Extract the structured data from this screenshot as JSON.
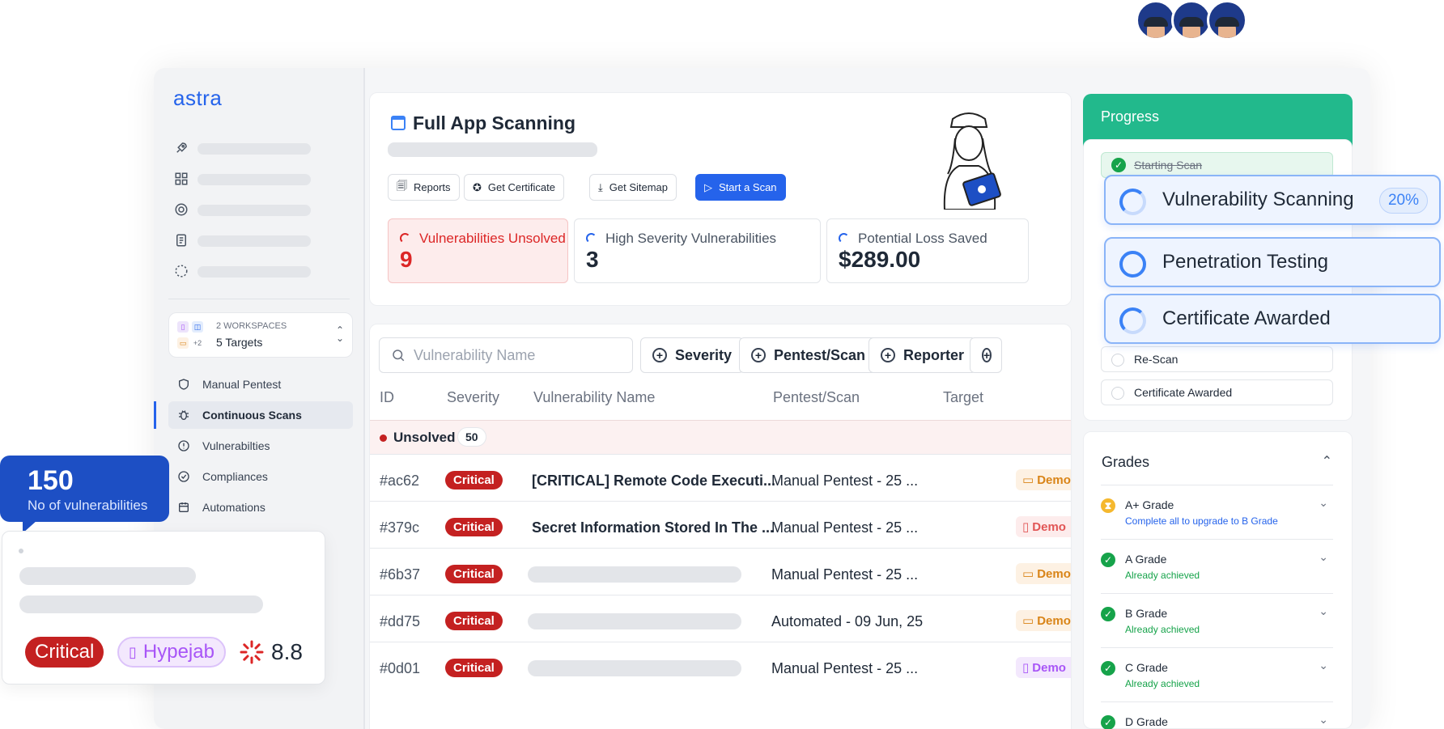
{
  "brand": {
    "logo_text": "astra",
    "accent": "#2563eb",
    "success": "#22b98c",
    "danger": "#c42121"
  },
  "sidebar": {
    "nav_icons": [
      "rocket-icon",
      "grid-icon",
      "target-icon",
      "report-icon",
      "scan-icon"
    ],
    "workspace": {
      "title": "2 WORKSPACES",
      "subtitle": "5 Targets",
      "extra_count": "+2"
    },
    "menu": [
      {
        "label": "Manual Pentest",
        "icon": "shield-icon"
      },
      {
        "label": "Continuous Scans",
        "icon": "bug-icon",
        "active": true
      },
      {
        "label": "Vulnerabilties",
        "icon": "alert-icon"
      },
      {
        "label": "Compliances",
        "icon": "badge-check-icon"
      },
      {
        "label": "Automations",
        "icon": "calendar-icon"
      }
    ]
  },
  "header": {
    "title": "Full App Scanning",
    "buttons": {
      "reports": "Reports",
      "certificate": "Get Certificate",
      "sitemap": "Get Sitemap",
      "start": "Start a Scan"
    }
  },
  "stats": [
    {
      "label": "Vulnerabilities Unsolved",
      "value": "9"
    },
    {
      "label": "High Severity Vulnerabilities",
      "value": "3"
    },
    {
      "label": "Potential Loss Saved",
      "value": "$289.00"
    }
  ],
  "filters": {
    "search_placeholder": "Vulnerability Name",
    "severity": "Severity",
    "pentest": "Pentest/Scan",
    "reporter": "Reporter"
  },
  "table": {
    "columns": [
      "ID",
      "Severity",
      "Vulnerability Name",
      "Pentest/Scan",
      "Target"
    ],
    "group": {
      "label": "Unsolved",
      "count": "50"
    },
    "rows": [
      {
        "id": "#ac62",
        "severity": "Critical",
        "name": "[CRITICAL] Remote Code Executi...",
        "scan": "Manual Pentest - 25 ...",
        "target": "Demo"
      },
      {
        "id": "#379c",
        "severity": "Critical",
        "name": "Secret Information Stored In The ...",
        "scan": "Manual Pentest - 25 ...",
        "target": "Demo"
      },
      {
        "id": "#6b37",
        "severity": "Critical",
        "name": "",
        "scan": "Manual Pentest - 25 ...",
        "target": "Demo"
      },
      {
        "id": "#dd75",
        "severity": "Critical",
        "name": "",
        "scan": "Automated - 09 Jun, 25",
        "target": "Demo"
      },
      {
        "id": "#0d01",
        "severity": "Critical",
        "name": "",
        "scan": "Manual Pentest - 25 ...",
        "target": "Demo"
      }
    ]
  },
  "progress": {
    "title": "Progress",
    "steps_done": [
      "Starting Scan"
    ],
    "active_steps": [
      {
        "label": "Vulnerability Scanning",
        "percent": "20%"
      },
      {
        "label": "Penetration Testing"
      },
      {
        "label": "Certificate Awarded"
      }
    ],
    "pending_steps": [
      "Re-Scan",
      "Certificate Awarded"
    ]
  },
  "grades": {
    "title": "Grades",
    "items": [
      {
        "grade": "A+ Grade",
        "status": "Complete all to upgrade to B Grade"
      },
      {
        "grade": "A Grade",
        "status": "Already achieved"
      },
      {
        "grade": "B Grade",
        "status": "Already achieved"
      },
      {
        "grade": "C Grade",
        "status": "Already achieved"
      },
      {
        "grade": "D Grade",
        "status": ""
      }
    ]
  },
  "overlay": {
    "count": "150",
    "count_label": "No of vulnerabilities",
    "severity": "Critical",
    "target": "Hypejab",
    "score": "8.8"
  }
}
